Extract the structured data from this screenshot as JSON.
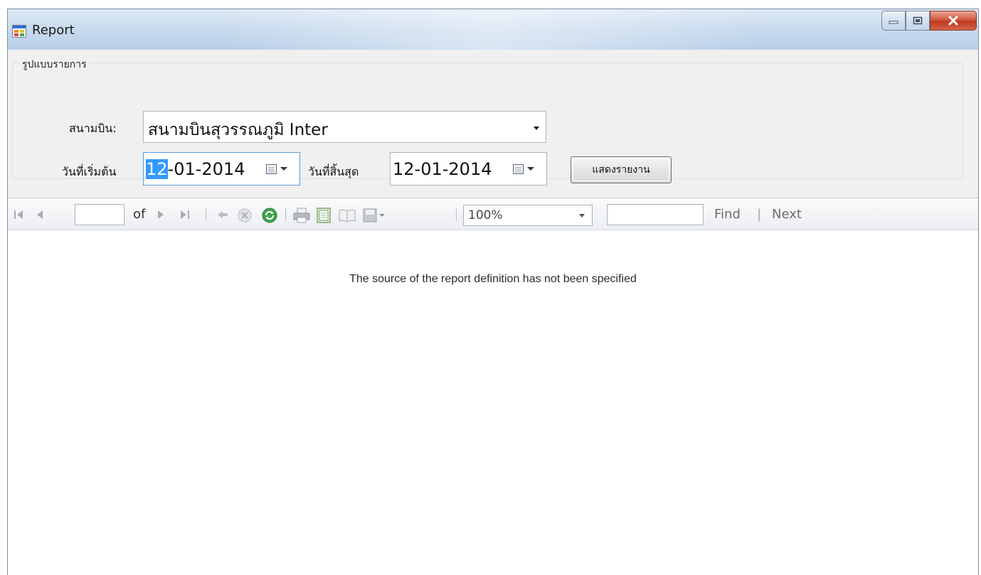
{
  "window": {
    "title": "Report",
    "icon": "app-form-icon"
  },
  "caption_buttons": {
    "minimize_icon": "minimize-icon",
    "maximize_icon": "maximize-icon",
    "close_icon": "close-icon"
  },
  "groupbox": {
    "legend": "รูปแบบรายการ"
  },
  "airport": {
    "label": "สนามบิน:",
    "selected": "สนามบินสุวรรณภูมิ Inter"
  },
  "start_date": {
    "label": "วันที่เริ่มต้น",
    "selected_part": "12",
    "rest": "-01-2014"
  },
  "end_date": {
    "label": "วันที่สิ้นสุด",
    "value": "12-01-2014"
  },
  "show_report_button": "แสดงรายงาน",
  "report_toolbar": {
    "page_value": "",
    "of_label": "of",
    "zoom_value": "100%",
    "find_value": "",
    "find_label": "Find",
    "separator": "|",
    "next_label": "Next"
  },
  "report_viewer": {
    "message": "The source of the report definition has not been specified"
  },
  "colors": {
    "titlebar": "#c9dbee",
    "client": "#f0f0f0",
    "selection": "#3399ff",
    "close_button": "#c7432a"
  }
}
